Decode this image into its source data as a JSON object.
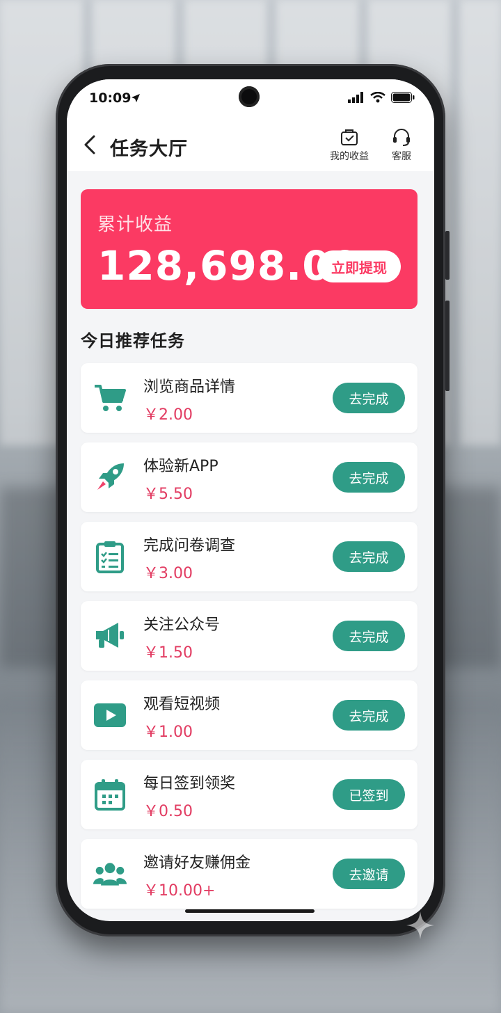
{
  "status": {
    "time": "10:09"
  },
  "nav": {
    "title": "任务大厅",
    "my_earnings": "我的收益",
    "support": "客服"
  },
  "earnings": {
    "label": "累计收益",
    "amount": "128,698.00",
    "withdraw": "立即提现"
  },
  "section_title": "今日推荐任务",
  "tasks": [
    {
      "name": "浏览商品详情",
      "reward": "￥2.00",
      "button": "去完成",
      "icon": "shopping-cart-icon"
    },
    {
      "name": "体验新APP",
      "reward": "￥5.50",
      "button": "去完成",
      "icon": "rocket-icon"
    },
    {
      "name": "完成问卷调查",
      "reward": "￥3.00",
      "button": "去完成",
      "icon": "clipboard-checklist-icon"
    },
    {
      "name": "关注公众号",
      "reward": "￥1.50",
      "button": "去完成",
      "icon": "megaphone-icon"
    },
    {
      "name": "观看短视频",
      "reward": "￥1.00",
      "button": "去完成",
      "icon": "play-video-icon"
    },
    {
      "name": "每日签到领奖",
      "reward": "￥0.50",
      "button": "已签到",
      "icon": "calendar-icon"
    },
    {
      "name": "邀请好友赚佣金",
      "reward": "￥10.00+",
      "button": "去邀请",
      "icon": "users-icon"
    }
  ],
  "colors": {
    "accent_red": "#fb3a63",
    "accent_green": "#2f9c87",
    "reward_red": "#e23c62"
  }
}
